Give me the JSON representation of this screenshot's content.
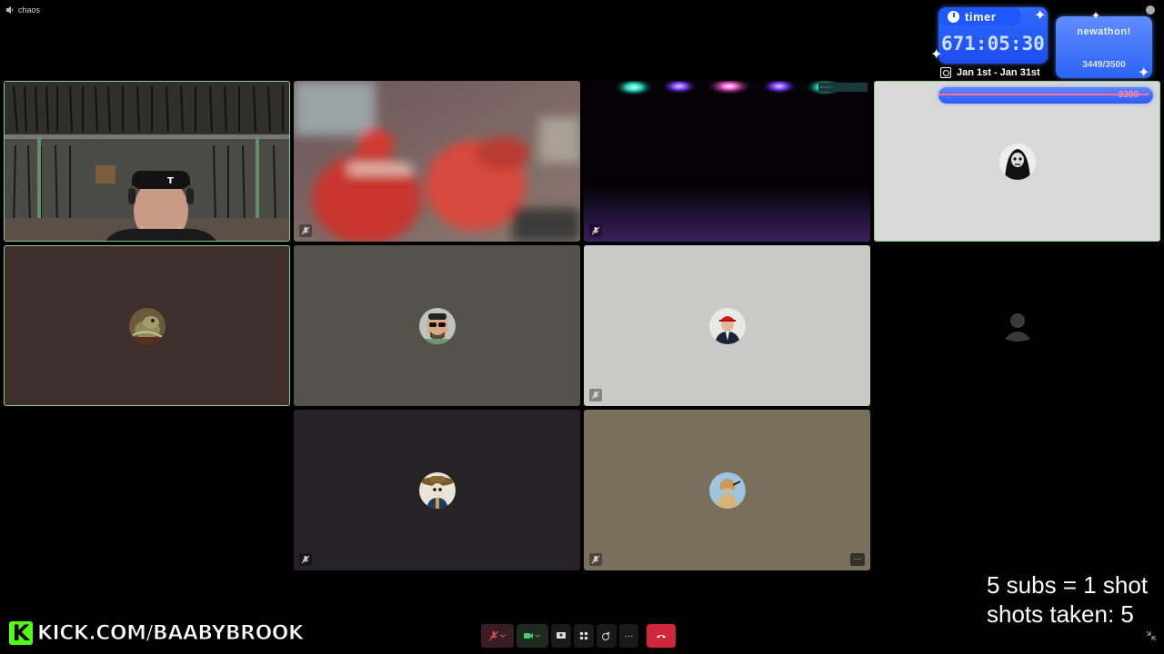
{
  "window": {
    "title": "chaos"
  },
  "timer": {
    "label": "timer",
    "value": "671:05:30",
    "dates": "Jan 1st - Jan 31st"
  },
  "goal": {
    "title": "newathon!",
    "count": "3449/3500",
    "progress_label": "3300",
    "progress_fraction": 0.98
  },
  "shots": {
    "line1": "5 subs = 1 shot",
    "line2": "shots taken: 5"
  },
  "branding": {
    "kick_letter": "K",
    "kick_url": "KICK.COM/BAABYBROOK"
  },
  "colors": {
    "kick_green": "#53fc18",
    "overlay_blue": "#2f6bff",
    "end_call_red": "#d0273a",
    "active_border": "#8ec98b"
  },
  "participants": [
    {
      "id": "p1",
      "type": "video",
      "scene": "armory-webcam",
      "active": true
    },
    {
      "id": "p2",
      "type": "video",
      "scene": "blurred-red-figure",
      "muted": true
    },
    {
      "id": "p3",
      "type": "video",
      "scene": "dark-stage-lights",
      "muted": true
    },
    {
      "id": "p4",
      "type": "avatar",
      "icon": "reaper-avatar-icon",
      "active": true
    },
    {
      "id": "p5",
      "type": "avatar",
      "icon": "creature-avatar-icon",
      "active": true
    },
    {
      "id": "p6",
      "type": "avatar",
      "icon": "sunglasses-man-avatar-icon"
    },
    {
      "id": "p7",
      "type": "avatar",
      "icon": "red-cap-man-avatar-icon",
      "muted": true
    },
    {
      "id": "p8",
      "type": "placeholder",
      "icon": "default-user-icon"
    },
    {
      "id": "p9",
      "type": "avatar",
      "icon": "skeleton-sombrero-avatar-icon",
      "muted": true
    },
    {
      "id": "p10",
      "type": "avatar",
      "icon": "person-photo-avatar-icon",
      "muted": true,
      "more_label": "···"
    }
  ],
  "toolbar": {
    "items": [
      "microphone-muted-icon",
      "camera-icon",
      "share-screen-icon",
      "grid-view-icon",
      "effects-icon",
      "more-icon",
      "end-call-icon"
    ],
    "more_label": "···"
  }
}
